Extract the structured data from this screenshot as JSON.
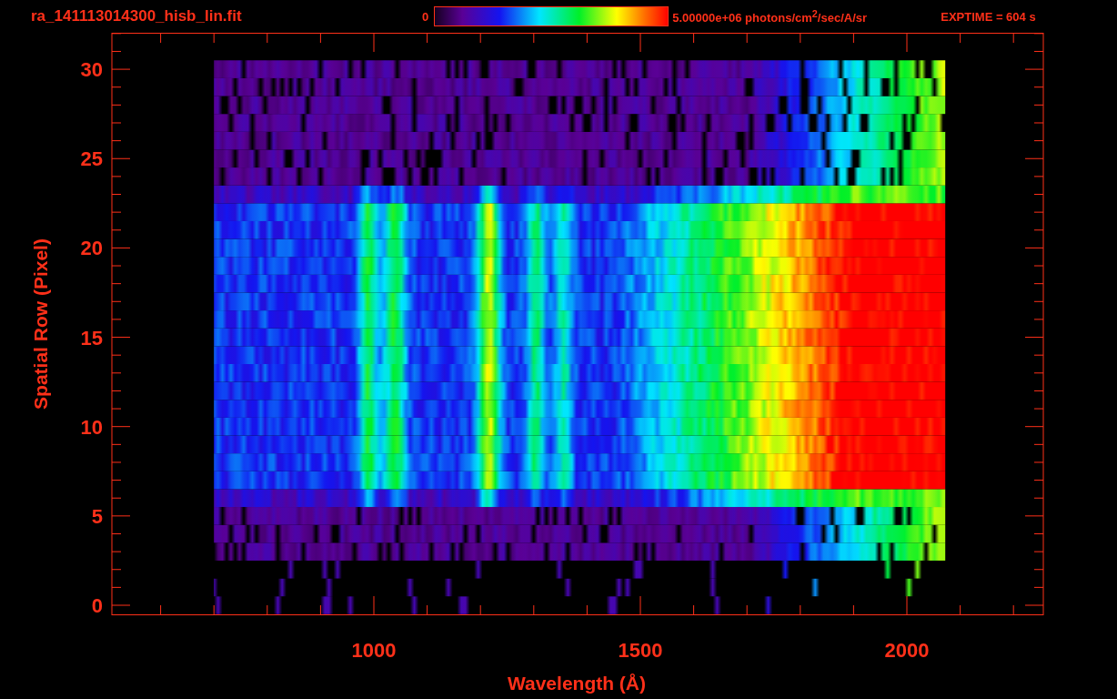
{
  "title": "ra_141113014300_hisb_lin.fit",
  "colorbar": {
    "min_label": "0",
    "max_label": "5.00000e+06 photons/cm$^{2}$/sec/A/sr"
  },
  "exptime": "EXPTIME = 604 s",
  "y_axis": {
    "label": "Spatial Row (Pixel)",
    "ticks": [
      "30",
      "25",
      "20",
      "15",
      "10",
      "5",
      "0"
    ]
  },
  "x_axis": {
    "label": "Wavelength (Å)",
    "ticks": [
      "1000",
      "1500",
      "2000"
    ]
  }
}
